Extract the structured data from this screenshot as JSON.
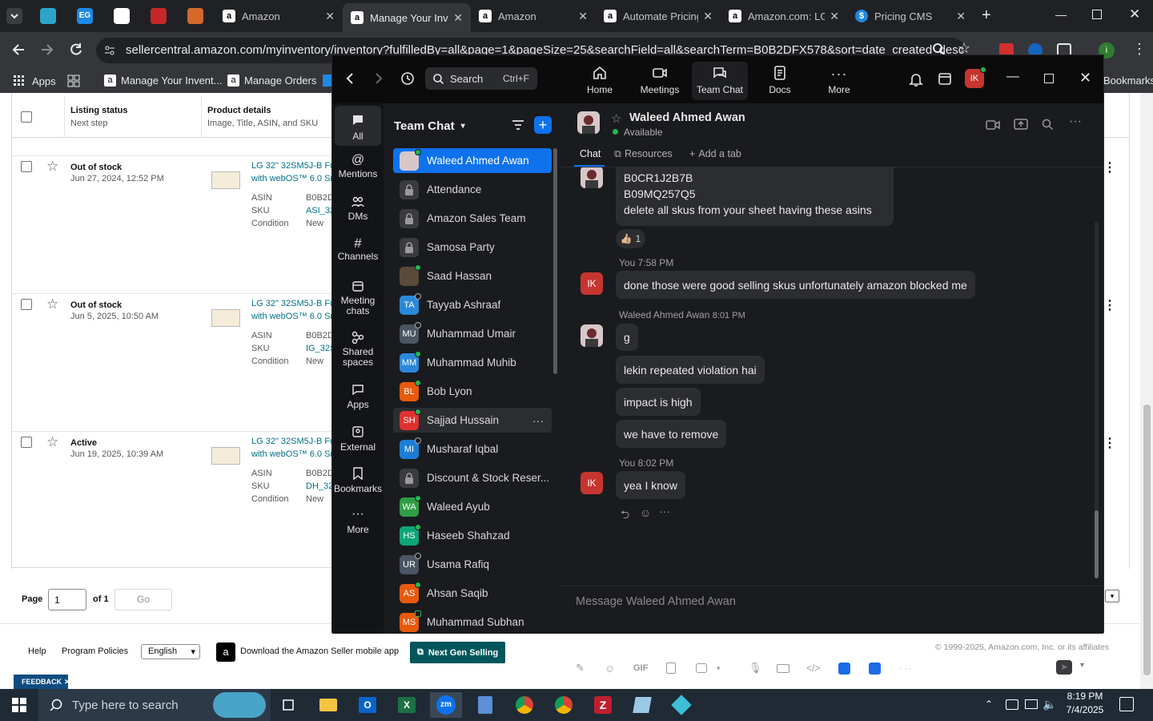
{
  "browser": {
    "tabs": [
      {
        "title": "Amazon",
        "icon": "amazon-icon"
      },
      {
        "title": "Manage Your Inventory",
        "icon": "amazon-icon",
        "active": true
      },
      {
        "title": "Amazon",
        "icon": "amazon-icon"
      },
      {
        "title": "Automate Pricing",
        "icon": "amazon-icon"
      },
      {
        "title": "Amazon.com: LG",
        "icon": "amazon-icon"
      },
      {
        "title": "Pricing CMS",
        "icon": "dollar-icon"
      }
    ],
    "url": "sellercentral.amazon.com/myinventory/inventory?fulfilledBy=all&page=1&pageSize=25&searchField=all&searchTerm=B0B2DFX578&sort=date_created_desc&...",
    "bookmarks": {
      "apps": "Apps",
      "manage_inventory": "Manage Your Invent...",
      "manage_orders": "Manage Orders",
      "right_label": "Bookmarks"
    }
  },
  "inventory": {
    "headers": {
      "status": "Listing status",
      "status_sub": "Next step",
      "product": "Product details",
      "product_sub": "Image, Title, ASIN, and SKU"
    },
    "rows": [
      {
        "status": "Out of stock",
        "date": "Jun 27, 2024, 12:52 PM",
        "title1": "LG 32\" 32SM5J-B Fu",
        "title2": "with webOS™ 6.0 Sr",
        "asin": "B0B2D",
        "sku": "ASI_32",
        "condition": "New"
      },
      {
        "status": "Out of stock",
        "date": "Jun 5, 2025, 10:50 AM",
        "title1": "LG 32\" 32SM5J-B Fu",
        "title2": "with webOS™ 6.0 Sr",
        "asin": "B0B2D",
        "sku": "IG_32S",
        "condition": "New"
      },
      {
        "status": "Active",
        "date": "Jun 19, 2025, 10:39 AM",
        "title1": "LG 32\" 32SM5J-B Fu",
        "title2": "with webOS™ 6.0 Sr",
        "asin": "B0B2D",
        "sku": "DH_32",
        "condition": "New"
      }
    ],
    "labels": {
      "asin": "ASIN",
      "sku": "SKU",
      "condition": "Condition"
    },
    "pager": {
      "page_label": "Page",
      "page_value": "1",
      "of_label": "of 1",
      "go": "Go"
    },
    "footer": {
      "help": "Help",
      "policies": "Program Policies",
      "language": "English",
      "app": "Download the Amazon Seller mobile app",
      "next_gen": "Next Gen Selling",
      "copyright": "© 1999-2025, Amazon.com, Inc. or its affiliates",
      "feedback": "FEEDBACK"
    }
  },
  "zoom": {
    "search_label": "Search",
    "search_shortcut": "Ctrl+F",
    "nav": [
      {
        "label": "Home",
        "icon": "home-icon"
      },
      {
        "label": "Meetings",
        "icon": "camera-icon"
      },
      {
        "label": "Team Chat",
        "icon": "chat-icon",
        "active": true
      },
      {
        "label": "Docs",
        "icon": "doc-icon"
      },
      {
        "label": "More",
        "icon": "more-icon"
      }
    ],
    "profile_initials": "IK",
    "rail": [
      {
        "label": "All",
        "icon": "chat-bubble-icon",
        "active": true
      },
      {
        "label": "Mentions",
        "icon": "at-icon"
      },
      {
        "label": "DMs",
        "icon": "people-icon"
      },
      {
        "label": "Channels",
        "icon": "hash-icon"
      },
      {
        "label": "Meeting chats",
        "icon": "calendar-icon"
      },
      {
        "label": "Shared spaces",
        "icon": "share-icon"
      },
      {
        "label": "Apps",
        "icon": "apps-icon"
      },
      {
        "label": "External",
        "icon": "external-icon"
      },
      {
        "label": "Bookmarks",
        "icon": "bookmark-icon"
      },
      {
        "label": "More",
        "icon": "more-icon"
      }
    ],
    "list_title": "Team Chat",
    "contacts": [
      {
        "name": "Waleed Ahmed Awan",
        "initials": "",
        "color": "#d8c7c9",
        "status": "online",
        "selected": true
      },
      {
        "name": "Attendance",
        "initials": "",
        "color": "#3a3b3f",
        "lock": true
      },
      {
        "name": "Amazon Sales Team",
        "initials": "",
        "color": "#3a3b3f",
        "lock": true
      },
      {
        "name": "Samosa Party",
        "initials": "",
        "color": "#3a3b3f",
        "lock": true
      },
      {
        "name": "Saad Hassan",
        "initials": "",
        "color": "#5a4a3a",
        "status": "online"
      },
      {
        "name": "Tayyab Ashraaf",
        "initials": "TA",
        "color": "#2b88d9",
        "status": "away"
      },
      {
        "name": "Muhammad Umair",
        "initials": "MU",
        "color": "#4b5563",
        "status": "away"
      },
      {
        "name": "Muhammad Muhib",
        "initials": "MM",
        "color": "#2b88d9",
        "status": "online"
      },
      {
        "name": "Bob Lyon",
        "initials": "BL",
        "color": "#e8590c",
        "status": "online"
      },
      {
        "name": "Sajjad Hussain",
        "initials": "SH",
        "color": "#e03131",
        "status": "online",
        "hover": true
      },
      {
        "name": "Musharaf Iqbal",
        "initials": "MI",
        "color": "#1c7ed6",
        "status": "away"
      },
      {
        "name": "Discount & Stock Reser...",
        "initials": "",
        "color": "#3a3b3f",
        "lock": true
      },
      {
        "name": "Waleed Ayub",
        "initials": "WA",
        "color": "#2f9e44",
        "status": "online"
      },
      {
        "name": "Haseeb Shahzad",
        "initials": "HS",
        "color": "#0ca678",
        "status": "online"
      },
      {
        "name": "Usama Rafiq",
        "initials": "UR",
        "color": "#4b5563",
        "status": "away"
      },
      {
        "name": "Ahsan Saqib",
        "initials": "AS",
        "color": "#e8590c",
        "status": "online"
      },
      {
        "name": "Muhammad Subhan",
        "initials": "MS",
        "color": "#e8590c",
        "status": "mobile"
      }
    ],
    "header": {
      "name": "Waleed Ahmed Awan",
      "status": "Available",
      "tabs": [
        "Chat",
        "Resources",
        "Add a tab"
      ]
    },
    "messages": {
      "b1": "B0CR1J2B7B",
      "b2": "B09MQ257Q5",
      "b3": "delete all skus from your sheet having these asins",
      "reaction": "👍🏼",
      "reaction_count": "1",
      "you1_meta": "You 7:58 PM",
      "you1": "done those were good selling skus  unfortunately amazon blocked me",
      "w_meta_name": "Waleed Ahmed Awan",
      "w_meta_time": "8:01 PM",
      "w1": "g",
      "w2": "lekin repeated violation hai",
      "w3": "impact is high",
      "w4": "we have to remove",
      "you2_meta": "You 8:02 PM",
      "you2": "yea I know"
    },
    "composer_placeholder": "Message Waleed Ahmed Awan",
    "gif": "GIF"
  },
  "taskbar": {
    "search": "Type here to search",
    "time": "8:19 PM",
    "date": "7/4/2025"
  }
}
